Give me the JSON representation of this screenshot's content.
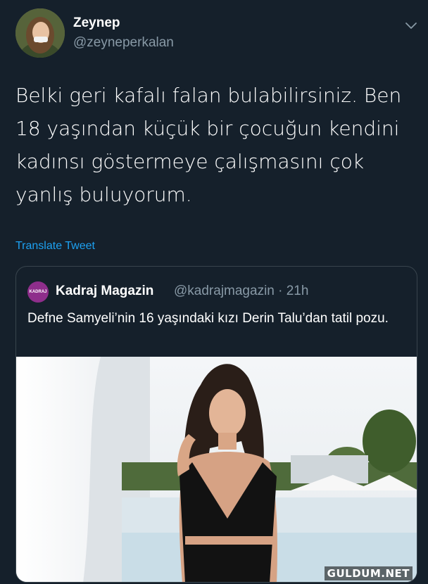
{
  "tweet": {
    "author": {
      "display_name": "Zeynep",
      "handle": "@zeyneperkalan",
      "avatar_icon": "profile-photo"
    },
    "menu_icon": "chevron-down-icon",
    "text": "Belki geri kafalı falan bulabilirsiniz. Ben 18 yaşından küçük bir çocuğun kendini kadınsı göstermeye çalışmasını çok yanlış buluyorum.",
    "translate_label": "Translate Tweet"
  },
  "quoted_tweet": {
    "author": {
      "display_name": "Kadraj Magazin",
      "handle_time": "@kadrajmagazin · 21h",
      "avatar_text": "KADRAJ"
    },
    "text": "Defne Samyeli’nin 16 yaşındaki kızı Derin Talu’dan tatil pozu.",
    "media_icon": "photo"
  },
  "watermark": "GULDUM.NET",
  "colors": {
    "background": "#15202b",
    "text_primary": "#ffffff",
    "text_secondary": "#8899a6",
    "link": "#1da1f2",
    "border": "#38444d",
    "quote_avatar": "#8e2e8b"
  }
}
